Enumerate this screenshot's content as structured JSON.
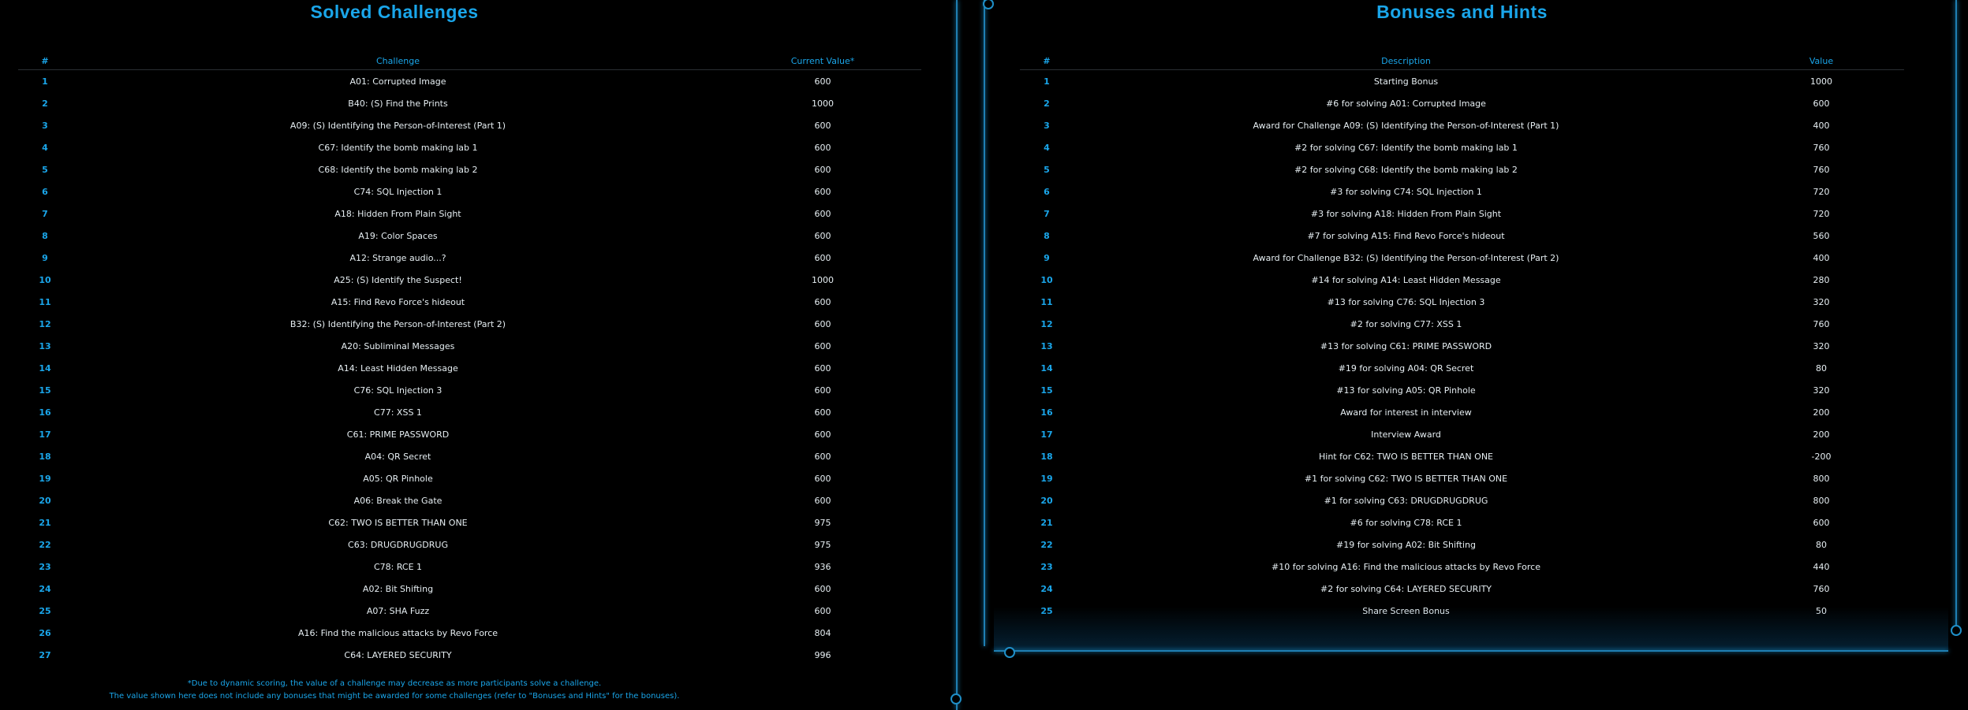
{
  "solved": {
    "title": "Solved Challenges",
    "headers": {
      "num": "#",
      "challenge": "Challenge",
      "value": "Current Value*"
    },
    "rows": [
      {
        "num": "1",
        "name": "A01: Corrupted Image",
        "value": "600"
      },
      {
        "num": "2",
        "name": "B40: (S) Find the Prints",
        "value": "1000"
      },
      {
        "num": "3",
        "name": "A09: (S) Identifying the Person-of-Interest (Part 1)",
        "value": "600"
      },
      {
        "num": "4",
        "name": "C67: Identify the bomb making lab 1",
        "value": "600"
      },
      {
        "num": "5",
        "name": "C68: Identify the bomb making lab 2",
        "value": "600"
      },
      {
        "num": "6",
        "name": "C74: SQL Injection 1",
        "value": "600"
      },
      {
        "num": "7",
        "name": "A18: Hidden From Plain Sight",
        "value": "600"
      },
      {
        "num": "8",
        "name": "A19: Color Spaces",
        "value": "600"
      },
      {
        "num": "9",
        "name": "A12: Strange audio...?",
        "value": "600"
      },
      {
        "num": "10",
        "name": "A25: (S) Identify the Suspect!",
        "value": "1000"
      },
      {
        "num": "11",
        "name": "A15: Find Revo Force's hideout",
        "value": "600"
      },
      {
        "num": "12",
        "name": "B32: (S) Identifying the Person-of-Interest (Part 2)",
        "value": "600"
      },
      {
        "num": "13",
        "name": "A20: Subliminal Messages",
        "value": "600"
      },
      {
        "num": "14",
        "name": "A14: Least Hidden Message",
        "value": "600"
      },
      {
        "num": "15",
        "name": "C76: SQL Injection 3",
        "value": "600"
      },
      {
        "num": "16",
        "name": "C77: XSS 1",
        "value": "600"
      },
      {
        "num": "17",
        "name": "C61: PRIME PASSWORD",
        "value": "600"
      },
      {
        "num": "18",
        "name": "A04: QR Secret",
        "value": "600"
      },
      {
        "num": "19",
        "name": "A05: QR Pinhole",
        "value": "600"
      },
      {
        "num": "20",
        "name": "A06: Break the Gate",
        "value": "600"
      },
      {
        "num": "21",
        "name": "C62: TWO IS BETTER THAN ONE",
        "value": "975"
      },
      {
        "num": "22",
        "name": "C63: DRUGDRUGDRUG",
        "value": "975"
      },
      {
        "num": "23",
        "name": "C78: RCE 1",
        "value": "936"
      },
      {
        "num": "24",
        "name": "A02: Bit Shifting",
        "value": "600"
      },
      {
        "num": "25",
        "name": "A07: SHA Fuzz",
        "value": "600"
      },
      {
        "num": "26",
        "name": "A16: Find the malicious attacks by Revo Force",
        "value": "804"
      },
      {
        "num": "27",
        "name": "C64: LAYERED SECURITY",
        "value": "996"
      }
    ],
    "footnote_1": "*Due to dynamic scoring, the value of a challenge may decrease as more participants solve a challenge.",
    "footnote_2": "The value shown here does not include any bonuses that might be awarded for some challenges (refer to \"Bonuses and Hints\" for the bonuses)."
  },
  "bonuses": {
    "title": "Bonuses and Hints",
    "headers": {
      "num": "#",
      "description": "Description",
      "value": "Value"
    },
    "rows": [
      {
        "num": "1",
        "desc": "Starting Bonus",
        "value": "1000"
      },
      {
        "num": "2",
        "desc": "#6 for solving A01: Corrupted Image",
        "value": "600"
      },
      {
        "num": "3",
        "desc": "Award for Challenge A09: (S) Identifying the Person-of-Interest (Part 1)",
        "value": "400"
      },
      {
        "num": "4",
        "desc": "#2 for solving C67: Identify the bomb making lab 1",
        "value": "760"
      },
      {
        "num": "5",
        "desc": "#2 for solving C68: Identify the bomb making lab 2",
        "value": "760"
      },
      {
        "num": "6",
        "desc": "#3 for solving C74: SQL Injection 1",
        "value": "720"
      },
      {
        "num": "7",
        "desc": "#3 for solving A18: Hidden From Plain Sight",
        "value": "720"
      },
      {
        "num": "8",
        "desc": "#7 for solving A15: Find Revo Force's hideout",
        "value": "560"
      },
      {
        "num": "9",
        "desc": "Award for Challenge B32: (S) Identifying the Person-of-Interest (Part 2)",
        "value": "400"
      },
      {
        "num": "10",
        "desc": "#14 for solving A14: Least Hidden Message",
        "value": "280"
      },
      {
        "num": "11",
        "desc": "#13 for solving C76: SQL Injection 3",
        "value": "320"
      },
      {
        "num": "12",
        "desc": "#2 for solving C77: XSS 1",
        "value": "760"
      },
      {
        "num": "13",
        "desc": "#13 for solving C61: PRIME PASSWORD",
        "value": "320"
      },
      {
        "num": "14",
        "desc": "#19 for solving A04: QR Secret",
        "value": "80"
      },
      {
        "num": "15",
        "desc": "#13 for solving A05: QR Pinhole",
        "value": "320"
      },
      {
        "num": "16",
        "desc": "Award for interest in interview",
        "value": "200"
      },
      {
        "num": "17",
        "desc": "Interview Award",
        "value": "200"
      },
      {
        "num": "18",
        "desc": "Hint for C62: TWO IS BETTER THAN ONE",
        "value": "-200"
      },
      {
        "num": "19",
        "desc": "#1 for solving C62: TWO IS BETTER THAN ONE",
        "value": "800"
      },
      {
        "num": "20",
        "desc": "#1 for solving C63: DRUGDRUGDRUG",
        "value": "800"
      },
      {
        "num": "21",
        "desc": "#6 for solving C78: RCE 1",
        "value": "600"
      },
      {
        "num": "22",
        "desc": "#19 for solving A02: Bit Shifting",
        "value": "80"
      },
      {
        "num": "23",
        "desc": "#10 for solving A16: Find the malicious attacks by Revo Force",
        "value": "440"
      },
      {
        "num": "24",
        "desc": "#2 for solving C64: LAYERED SECURITY",
        "value": "760"
      },
      {
        "num": "25",
        "desc": "Share Screen Bonus",
        "value": "50"
      }
    ]
  },
  "colors": {
    "accent": "#1aa6ea",
    "background": "#000000",
    "text": "#e6eef2",
    "frame": "#1f7fb3"
  }
}
